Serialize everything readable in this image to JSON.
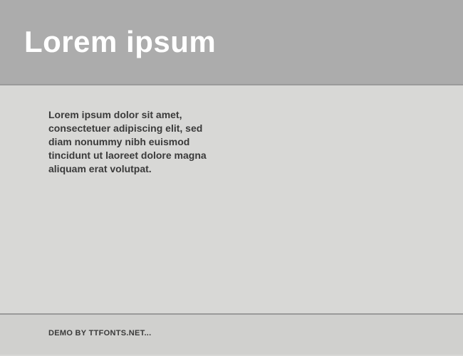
{
  "header": {
    "title": "Lorem ipsum"
  },
  "content": {
    "body": "Lorem ipsum dolor sit amet, consectetuer adipiscing elit, sed diam nonummy nibh euismod tincidunt ut laoreet dolore magna aliquam erat volutpat."
  },
  "footer": {
    "text": "DEMO BY TTFONTS.NET..."
  }
}
